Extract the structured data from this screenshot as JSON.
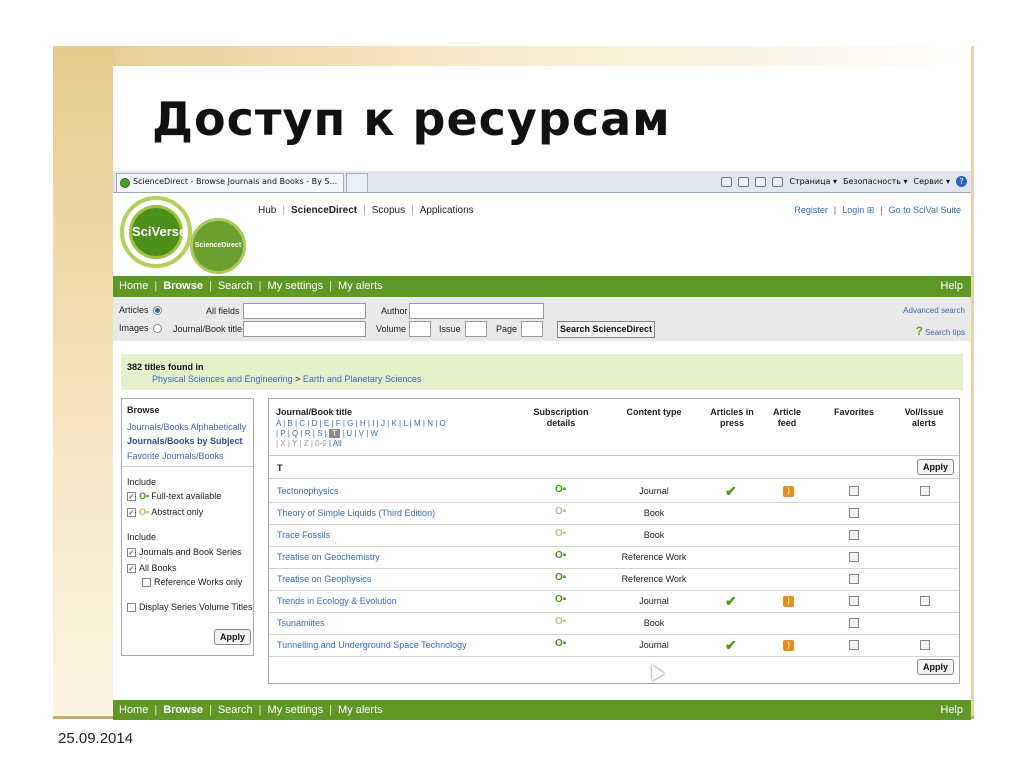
{
  "slide": {
    "title": "Доступ к ресурсам",
    "date": "25.09.2014"
  },
  "browser": {
    "tab_title": "ScienceDirect - Browse Journals and Books - By S...",
    "menu_page": "Страница ▾",
    "menu_security": "Безопасность ▾",
    "menu_service": "Сервис ▾"
  },
  "header": {
    "logo": "SciVerse",
    "logo_sub": "ScienceDirect",
    "links": [
      "Hub",
      "ScienceDirect",
      "Scopus",
      "Applications"
    ],
    "register": "Register",
    "login": "Login ⊞",
    "scival": "Go to SciVal Suite"
  },
  "nav": {
    "home": "Home",
    "browse": "Browse",
    "search": "Search",
    "settings": "My settings",
    "alerts": "My alerts",
    "help": "Help"
  },
  "search": {
    "articles": "Articles",
    "images": "Images",
    "all_fields": "All fields",
    "journal_title": "Journal/Book title",
    "author": "Author",
    "volume": "Volume",
    "issue": "Issue",
    "page": "Page",
    "button": "Search ScienceDirect",
    "advanced": "Advanced search",
    "tips": "Search tips"
  },
  "results": {
    "count": "382 titles found in",
    "crumb_a": "Physical Sciences and Engineering",
    "crumb_b": " > ",
    "crumb_c": "Earth and Planetary Sciences"
  },
  "left_panel": {
    "browse": "Browse",
    "alpha": "Journals/Books Alphabetically",
    "subject": "Journals/Books by Subject",
    "favorite": "Favorite Journals/Books",
    "include1": "Include",
    "fulltext": "Full-text available",
    "abstract": "Abstract only",
    "include2": "Include",
    "journals_series": "Journals and Book Series",
    "all_books": "All Books",
    "reference": "Reference Works only",
    "display_series": "Display Series Volume Titles",
    "apply": "Apply"
  },
  "table": {
    "headers": {
      "title": "Journal/Book title",
      "subscription": "Subscription details",
      "content_type": "Content type",
      "in_press": "Articles in press",
      "feed": "Article feed",
      "favorites": "Favorites",
      "alerts": "Vol/Issue alerts"
    },
    "letters_1": "A | B | C | D | E | F | G | H | I | J | K | L | M | N | O",
    "letters_2a": "| P | Q | R | S |",
    "letters_cur": "T",
    "letters_2b": "| U | V | W",
    "letters_3a": "| X | Y | Z | 0-9",
    "letters_3b": "| All",
    "section": "T",
    "apply": "Apply",
    "rows": [
      {
        "title": "Tectonophysics",
        "content_type": "Journal"
      },
      {
        "title": "Theory of Simple Liquids (Third Edition)",
        "content_type": "Book"
      },
      {
        "title": "Trace Fossils",
        "content_type": "Book"
      },
      {
        "title": "Treatise on Geochemistry",
        "content_type": "Reference Work"
      },
      {
        "title": "Treatise on Geophysics",
        "content_type": "Reference Work"
      },
      {
        "title": "Trends in Ecology & Evolution",
        "content_type": "Journal"
      },
      {
        "title": "Tsunamiites",
        "content_type": "Book"
      },
      {
        "title": "Tunnelling and Underground Space Technology",
        "content_type": "Journal"
      }
    ]
  }
}
